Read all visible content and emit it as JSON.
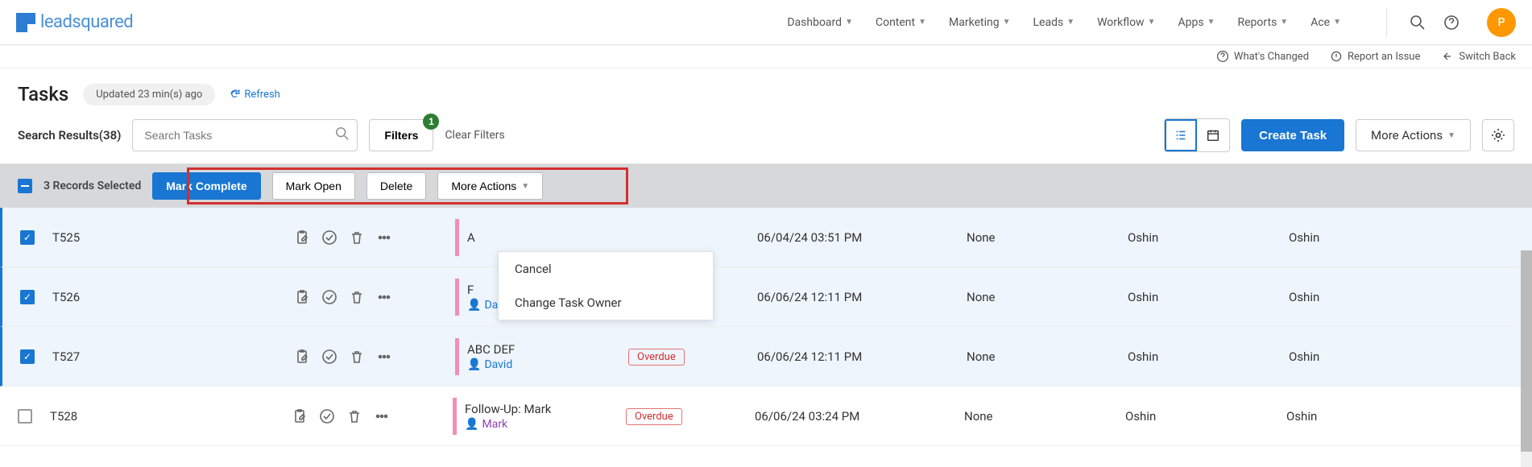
{
  "topnav": {
    "logo_text": "leadsquared",
    "items": [
      "Dashboard",
      "Content",
      "Marketing",
      "Leads",
      "Workflow",
      "Apps",
      "Reports",
      "Ace"
    ],
    "avatar_initial": "P"
  },
  "subbar": {
    "whats_changed": "What's Changed",
    "report_issue": "Report an Issue",
    "switch_back": "Switch Back"
  },
  "page": {
    "title": "Tasks",
    "updated": "Updated 23 min(s) ago",
    "refresh": "Refresh",
    "search_results": "Search Results(38)",
    "search_placeholder": "Search Tasks",
    "filters_label": "Filters",
    "filters_badge": "1",
    "clear_filters": "Clear Filters",
    "create_task": "Create Task",
    "more_actions": "More Actions"
  },
  "selbar": {
    "selected_text": "3 Records Selected",
    "mark_complete": "Mark Complete",
    "mark_open": "Mark Open",
    "delete": "Delete",
    "more_actions": "More Actions"
  },
  "dropdown": {
    "cancel": "Cancel",
    "change_owner": "Change Task Owner"
  },
  "rows": [
    {
      "id": "T525",
      "selected": true,
      "subject": "A",
      "person": "",
      "overdue": false,
      "date": "06/04/24 03:51 PM",
      "owner": "None",
      "assignee": "Oshin",
      "watcher": "Oshin"
    },
    {
      "id": "T526",
      "selected": true,
      "subject": "F",
      "person": "David",
      "overdue": true,
      "date": "06/06/24 12:11 PM",
      "owner": "None",
      "assignee": "Oshin",
      "watcher": "Oshin"
    },
    {
      "id": "T527",
      "selected": true,
      "subject": "ABC DEF",
      "person": "David",
      "overdue": true,
      "date": "06/06/24 12:11 PM",
      "owner": "None",
      "assignee": "Oshin",
      "watcher": "Oshin"
    },
    {
      "id": "T528",
      "selected": false,
      "subject": "Follow-Up: Mark",
      "person": "Mark",
      "person_class": "mark",
      "overdue": true,
      "date": "06/06/24 03:24 PM",
      "owner": "None",
      "assignee": "Oshin",
      "watcher": "Oshin"
    }
  ],
  "overdue_label": "Overdue"
}
